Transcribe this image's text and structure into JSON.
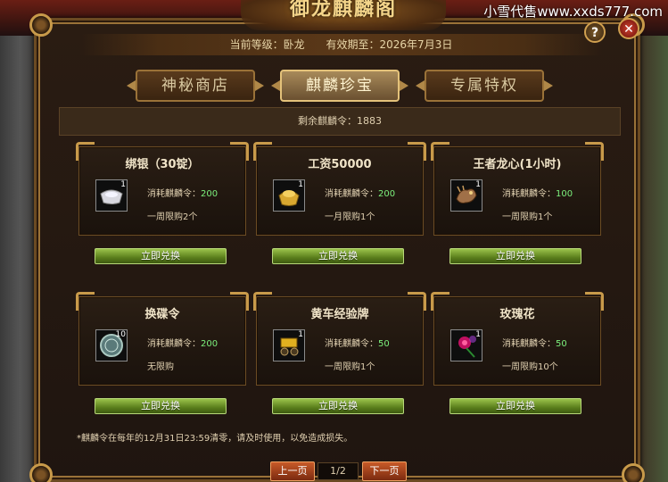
{
  "watermark": "小雪代售www.xxds777.com",
  "window_title": "御龙麒麟阁",
  "info": {
    "level_label": "当前等级：卧龙",
    "expiry_label": "有效期至：2026年7月3日"
  },
  "controls": {
    "help": "?",
    "close": "✕"
  },
  "tabs": [
    {
      "label": "神秘商店",
      "active": false
    },
    {
      "label": "麒麟珍宝",
      "active": true
    },
    {
      "label": "专属特权",
      "active": false
    }
  ],
  "remaining": "剩余麒麟令：1883",
  "cost_prefix": "消耗麒麟令：",
  "items": [
    {
      "title": "绑银（30锭）",
      "qty": "1",
      "icon": "silver-ingot-icon",
      "cost": "200",
      "limit": "一周限购2个",
      "button": "立即兑换"
    },
    {
      "title": "工资50000",
      "qty": "1",
      "icon": "gold-ingot-icon",
      "cost": "200",
      "limit": "一月限购1个",
      "button": "立即兑换"
    },
    {
      "title": "王者龙心(1小时)",
      "qty": "1",
      "icon": "dragon-heart-icon",
      "cost": "100",
      "limit": "一周限购1个",
      "button": "立即兑换"
    },
    {
      "title": "换碟令",
      "qty": "10",
      "icon": "token-disc-icon",
      "cost": "200",
      "limit": "无限购",
      "button": "立即兑换"
    },
    {
      "title": "黄车经验牌",
      "qty": "1",
      "icon": "yellow-cart-icon",
      "cost": "50",
      "limit": "一周限购1个",
      "button": "立即兑换"
    },
    {
      "title": "玫瑰花",
      "qty": "1",
      "icon": "rose-icon",
      "cost": "50",
      "limit": "一周限购10个",
      "button": "立即兑换"
    }
  ],
  "notice": "*麒麟令在每年的12月31日23:59清零，请及时使用，以免造成损失。",
  "pagination": {
    "prev": "上一页",
    "page": "1/2",
    "next": "下一页"
  }
}
